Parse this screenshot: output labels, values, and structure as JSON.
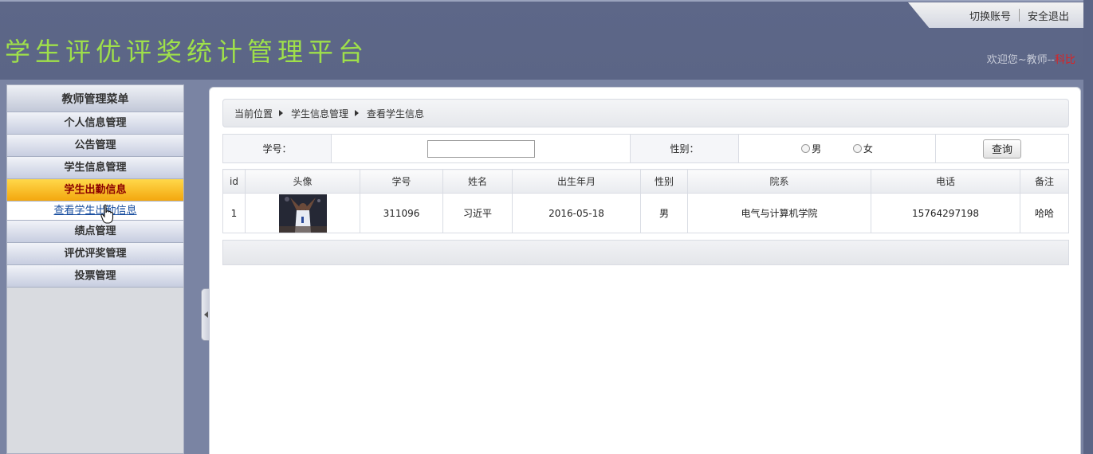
{
  "header": {
    "app_title": "学生评优评奖统计管理平台",
    "switch_account": "切换账号",
    "logout": "安全退出",
    "welcome_prefix": "欢迎您~教师--",
    "welcome_user": "科比"
  },
  "sidebar": {
    "title": "教师管理菜单",
    "items": [
      {
        "label": "个人信息管理"
      },
      {
        "label": "公告管理"
      },
      {
        "label": "学生信息管理"
      },
      {
        "label": "学生出勤信息"
      },
      {
        "label": "绩点管理"
      },
      {
        "label": "评优评奖管理"
      },
      {
        "label": "投票管理"
      }
    ],
    "sub_item": "查看学生出勤信息"
  },
  "breadcrumb": {
    "items": [
      "当前位置",
      "学生信息管理",
      "查看学生信息"
    ]
  },
  "search": {
    "student_no_label": "学号：",
    "student_no_value": "",
    "gender_label": "性别：",
    "male": "男",
    "female": "女",
    "query_button": "查询"
  },
  "table": {
    "headers": [
      "id",
      "头像",
      "学号",
      "姓名",
      "出生年月",
      "性别",
      "院系",
      "电话",
      "备注"
    ],
    "rows": [
      {
        "id": "1",
        "student_no": "311096",
        "name": "习近平",
        "birth": "2016-05-18",
        "gender": "男",
        "department": "电气与计算机学院",
        "phone": "15764297198",
        "remark": "哈哈"
      }
    ]
  },
  "colors": {
    "header_bg": "#5b6586",
    "title_green": "#9fe04a",
    "active_menu": "#f3a70e",
    "welcome_user": "#dd2222"
  }
}
